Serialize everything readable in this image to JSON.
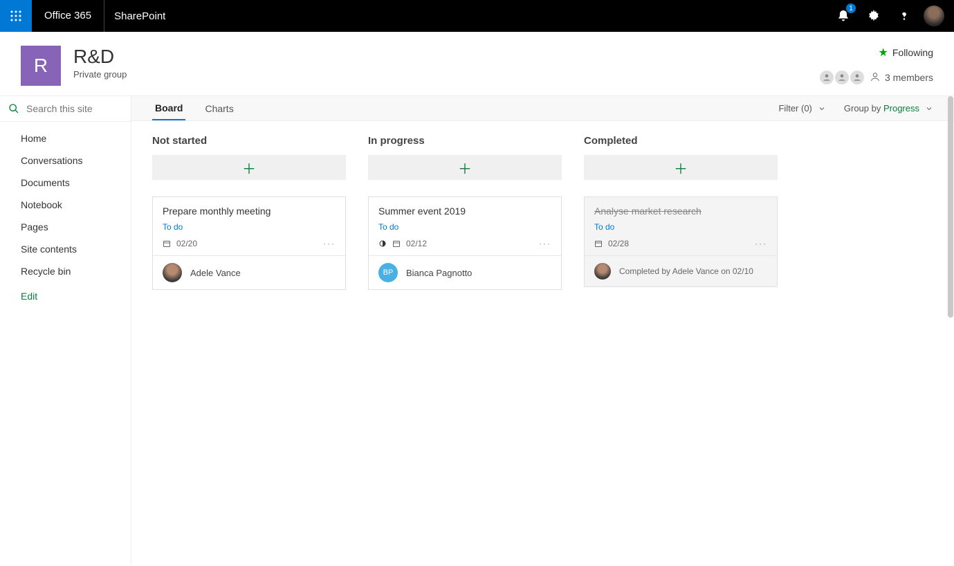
{
  "topnav": {
    "brand": "Office 365",
    "app": "SharePoint",
    "notification_count": "1"
  },
  "site": {
    "logo_initial": "R",
    "title": "R&D",
    "subtitle": "Private group",
    "following_label": "Following",
    "member_count_text": "3 members"
  },
  "search": {
    "placeholder": "Search this site"
  },
  "nav_items": [
    "Home",
    "Conversations",
    "Documents",
    "Notebook",
    "Pages",
    "Site contents",
    "Recycle bin"
  ],
  "nav_edit": "Edit",
  "tabs": {
    "board": "Board",
    "charts": "Charts"
  },
  "filters": {
    "filter_label": "Filter (0)",
    "group_prefix": "Group by ",
    "group_value": "Progress"
  },
  "columns": {
    "not_started": "Not started",
    "in_progress": "In progress",
    "completed": "Completed"
  },
  "cards": {
    "c1": {
      "title": "Prepare monthly meeting",
      "todo": "To do",
      "date": "02/20",
      "assignee": "Adele Vance"
    },
    "c2": {
      "title": "Summer event 2019",
      "todo": "To do",
      "date": "02/12",
      "assignee": "Bianca Pagnotto",
      "initials": "BP"
    },
    "c3": {
      "title": "Analyse market research",
      "todo": "To do",
      "date": "02/28",
      "completed_text": "Completed by Adele Vance on 02/10"
    }
  }
}
